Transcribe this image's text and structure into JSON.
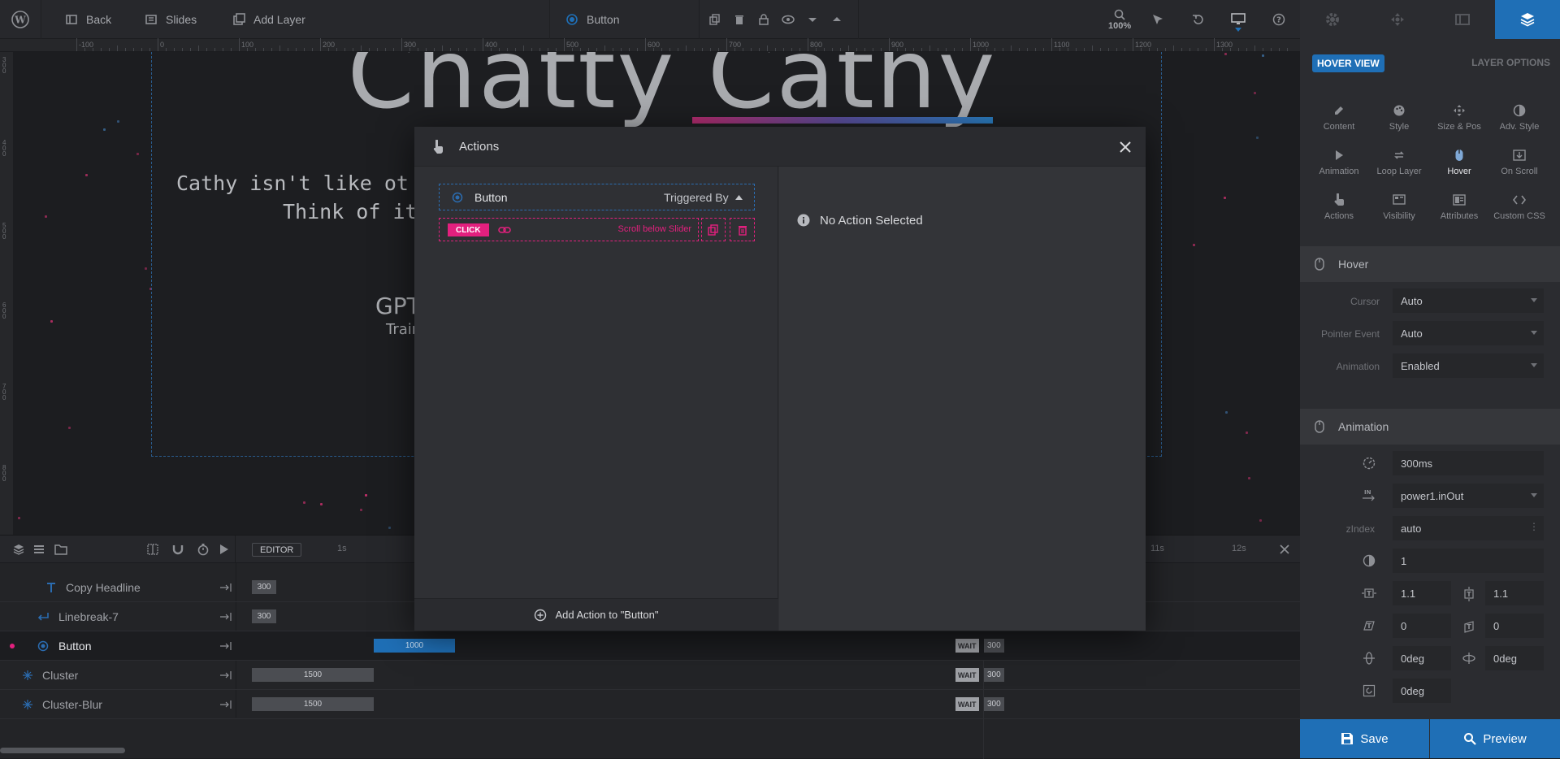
{
  "topbar": {
    "back": "Back",
    "slides": "Slides",
    "add_layer": "Add Layer",
    "current_layer": "Button",
    "zoom": "100%"
  },
  "ruler": {
    "labels": [
      "-100",
      "0",
      "100",
      "200",
      "300",
      "400",
      "500",
      "600",
      "700",
      "800",
      "900",
      "1000",
      "1100",
      "1200",
      "1300"
    ]
  },
  "canvas": {
    "headline": "Chatty Cathy",
    "line1": "Cathy isn't like ot",
    "line2": "Think of it",
    "gpt": "GPT",
    "train": "Train"
  },
  "timeline": {
    "editor": "EDITOR",
    "mark_1s": "1s",
    "mark_11s": "11s",
    "mark_12s": "12s",
    "wait_label": "WAIT",
    "rows": [
      {
        "name": "Copy Headline",
        "bar": "300",
        "wait": ""
      },
      {
        "name": "Linebreak-7",
        "bar": "300",
        "wait": ""
      },
      {
        "name": "Button",
        "bar": "1000",
        "wait": "300"
      },
      {
        "name": "Cluster",
        "bar": "1500",
        "wait": "300"
      },
      {
        "name": "Cluster-Blur",
        "bar": "1500",
        "wait": "300"
      }
    ]
  },
  "modal": {
    "title": "Actions",
    "layer_name": "Button",
    "triggered_by": "Triggered By",
    "action_event": "CLICK",
    "action_target": "Scroll below Slider",
    "add_action": "Add Action to \"Button\"",
    "no_action": "No Action Selected"
  },
  "panel": {
    "hover_view": "HOVER VIEW",
    "layer_options": "LAYER OPTIONS",
    "options": [
      {
        "label": "Content",
        "icon": "pencil-icon"
      },
      {
        "label": "Style",
        "icon": "palette-icon"
      },
      {
        "label": "Size & Pos",
        "icon": "move-icon"
      },
      {
        "label": "Adv. Style",
        "icon": "contrast-icon"
      },
      {
        "label": "Animation",
        "icon": "play-icon"
      },
      {
        "label": "Loop Layer",
        "icon": "loop-icon"
      },
      {
        "label": "Hover",
        "icon": "mouse-icon"
      },
      {
        "label": "On Scroll",
        "icon": "scroll-icon"
      },
      {
        "label": "Actions",
        "icon": "hand-icon"
      },
      {
        "label": "Visibility",
        "icon": "visibility-icon"
      },
      {
        "label": "Attributes",
        "icon": "attributes-icon"
      },
      {
        "label": "Custom CSS",
        "icon": "code-icon"
      }
    ],
    "hover_section": "Hover",
    "cursor_label": "Cursor",
    "cursor_value": "Auto",
    "pointer_label": "Pointer Event",
    "pointer_value": "Auto",
    "animation_label": "Animation",
    "animation_value": "Enabled",
    "animation_section": "Animation",
    "duration": "300ms",
    "easing": "power1.inOut",
    "zindex_label": "zIndex",
    "zindex": "auto",
    "opacity": "1",
    "scale_x": "1.1",
    "scale_y": "1.1",
    "skew_x": "0",
    "skew_y": "0",
    "rot_x": "0deg",
    "rot_y": "0deg",
    "rot_z": "0deg",
    "save": "Save",
    "preview": "Preview"
  },
  "colors": {
    "accent": "#1f6fb6",
    "pink": "#e3207e",
    "dot_pink": "#c2306a",
    "dot_blue": "#3c6ea0"
  }
}
